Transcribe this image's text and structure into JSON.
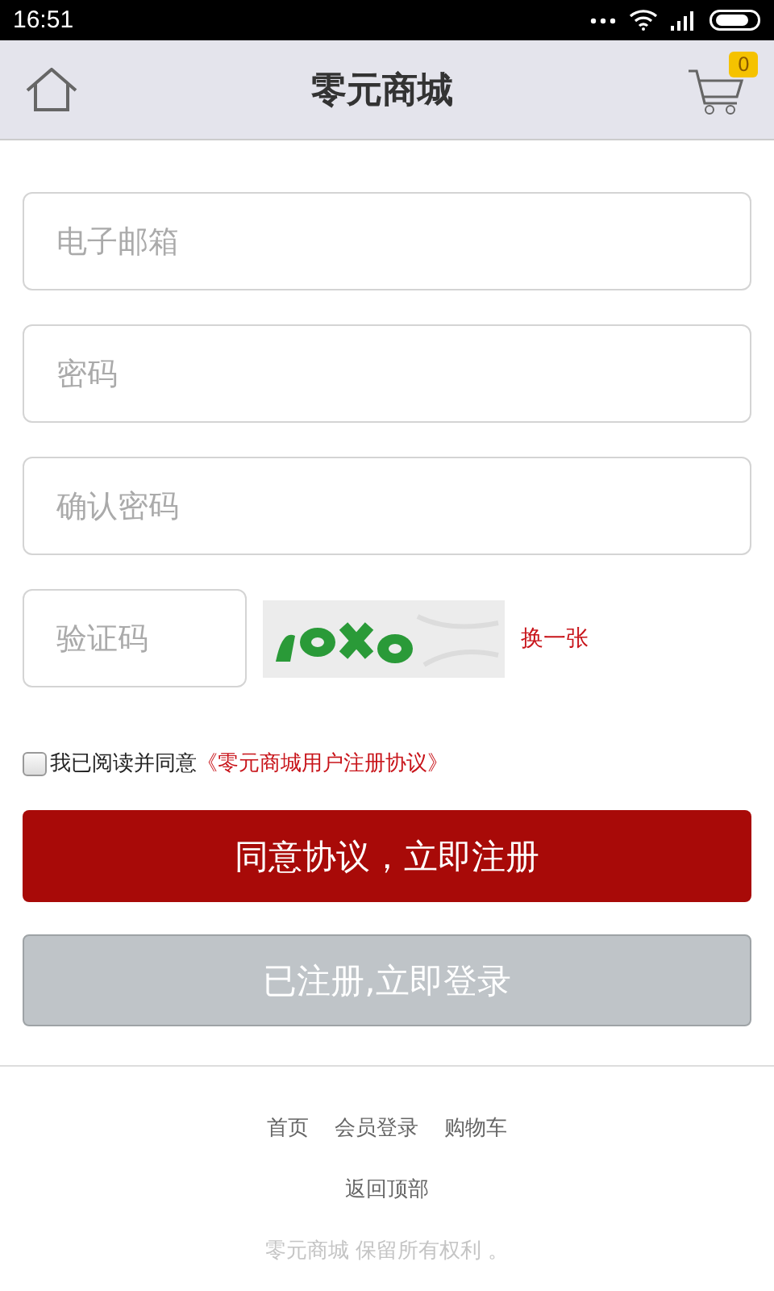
{
  "status_bar": {
    "time": "16:51"
  },
  "header": {
    "title": "零元商城",
    "cart_count": "0"
  },
  "fields": [
    {
      "placeholder": "电子邮箱"
    },
    {
      "placeholder": "密码"
    },
    {
      "placeholder": "确认密码"
    }
  ],
  "captcha": {
    "placeholder": "验证码",
    "refresh": "换一张"
  },
  "agreement": {
    "checked": false,
    "text": "我已阅读并同意",
    "link": "《零元商城用户注册协议》"
  },
  "buttons": [
    {
      "label": "同意协议，立即注册",
      "kind": "primary"
    },
    {
      "label": "已注册,立即登录",
      "kind": "secondary"
    }
  ],
  "footer": {
    "links": [
      "首页",
      "会员登录",
      "购物车"
    ],
    "back_to_top": "返回顶部",
    "copyright": "零元商城 保留所有权利 。"
  }
}
